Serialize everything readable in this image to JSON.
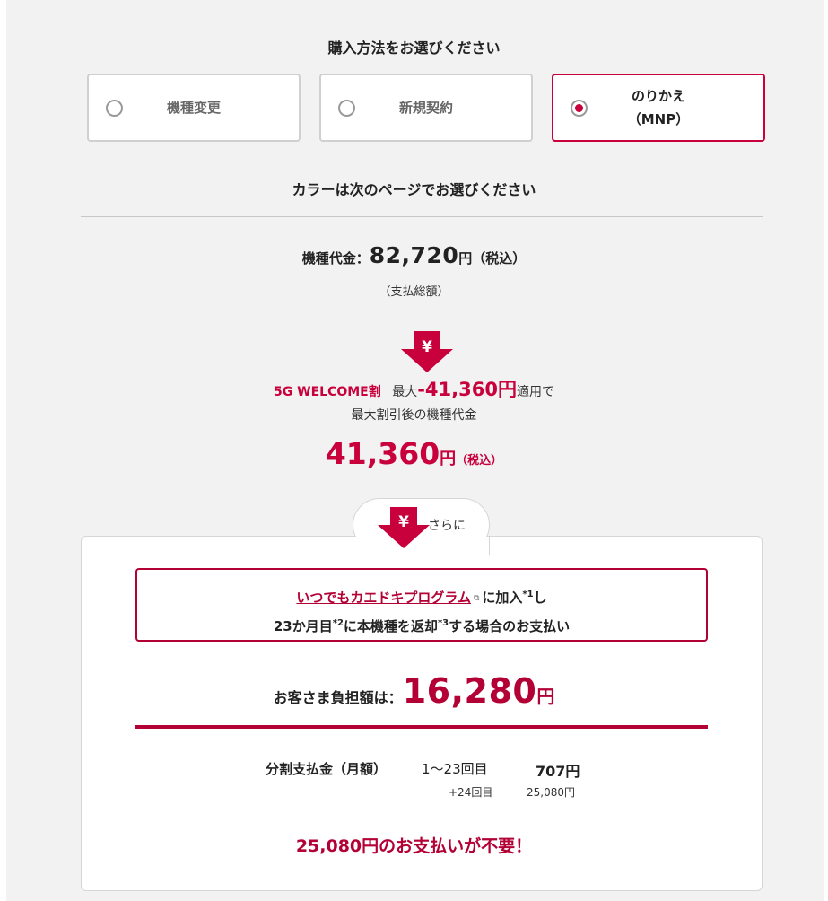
{
  "purchase": {
    "heading": "購入方法をお選びください",
    "options": [
      {
        "line1": "機種変更",
        "line2": "",
        "selected": false
      },
      {
        "line1": "新規契約",
        "line2": "",
        "selected": false
      },
      {
        "line1": "のりかえ",
        "line2": "（MNP）",
        "selected": true
      }
    ]
  },
  "color_note": "カラーは次のページでお選びください",
  "price": {
    "label": "機種代金：",
    "amount": "82,720",
    "yen": "円",
    "tax": "（税込）",
    "sub": "（支払総額）"
  },
  "discount": {
    "campaign": "5G WELCOME割",
    "max_label": "最大",
    "amount": "-41,360円",
    "suffix": "適用で",
    "sub": "最大割引後の機種代金"
  },
  "after_price": {
    "amount": "41,360",
    "yen": "円",
    "tax": "（税込）"
  },
  "furthermore": "さらに",
  "program": {
    "link": "いつでもカエドキプログラム",
    "join": "に加入",
    "note1": "*1",
    "join_tail": "し",
    "line2a": "23か月目",
    "note2": "*2",
    "line2b": "に本機種を返却",
    "note3": "*3",
    "line2c": "する場合のお支払い"
  },
  "burden": {
    "label": "お客さま負担額は：",
    "amount": "16,280",
    "yen": "円"
  },
  "installment": {
    "label": "分割支払金（月額）",
    "range": "1〜23回目",
    "amount": "707円",
    "range2": "+24回目",
    "amount2": "25,080円"
  },
  "no_payment": "25,080円のお支払いが不要！",
  "colors": {
    "accent": "#c8003c",
    "panel_bg": "#f2f2f2"
  }
}
